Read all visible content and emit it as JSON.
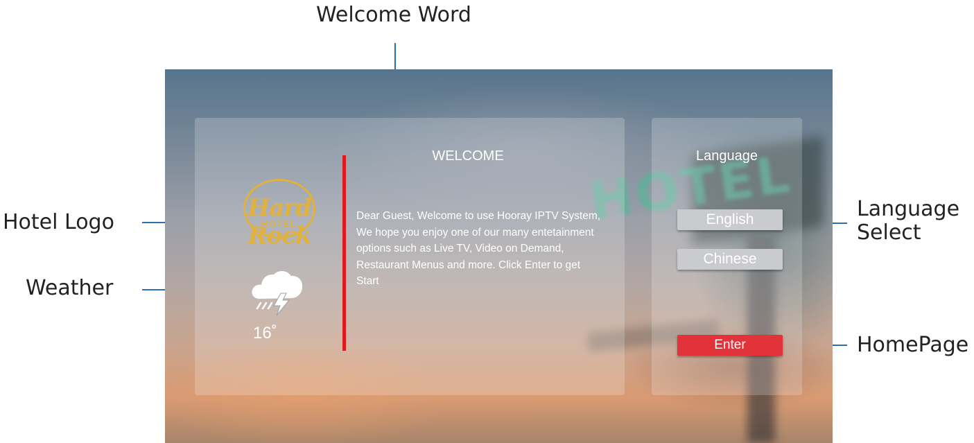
{
  "annotations": {
    "welcome_word": "Welcome Word",
    "hotel_logo": "Hotel Logo",
    "weather": "Weather",
    "language_select": "Language\nSelect",
    "homepage": "HomePage",
    "line_color": "#2c6fb0"
  },
  "screen": {
    "logo": {
      "wordmark": "Hard Rock",
      "subtitle": "HOTEL",
      "color": "#e0b13e"
    },
    "weather": {
      "icon": "thunderstorm-cloud-icon",
      "temperature": "16˚"
    },
    "welcome": {
      "title": "WELCOME",
      "message": "Dear Guest, Welcome to use Hooray IPTV System, We hope you enjoy one of our many entetainment options such as Live TV, Video on Demand, Restaurant Menus and more. Click Enter to get Start",
      "accent_color": "#e0191d"
    },
    "language": {
      "title": "Language",
      "options": [
        "English",
        "Chinese"
      ],
      "enter_label": "Enter",
      "enter_color": "#e2333b"
    }
  }
}
